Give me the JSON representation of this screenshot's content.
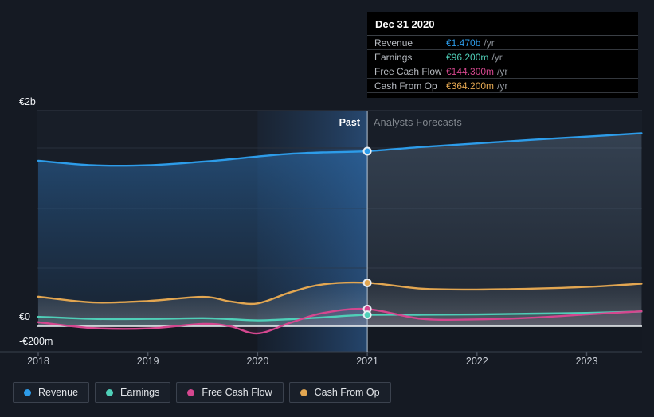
{
  "colors": {
    "revenue": "#2D9CE9",
    "earnings": "#4FCFB8",
    "free_cash_flow": "#D5478F",
    "cash_from_op": "#E2A651",
    "background": "#151A23",
    "plot_background": "#181E28",
    "tooltip_background": "#000000",
    "zero_line": "#F2F5F7"
  },
  "tooltip": {
    "date": "Dec 31 2020",
    "rows": [
      {
        "label": "Revenue",
        "value": "€1.470b",
        "suffix": "/yr",
        "series": "revenue"
      },
      {
        "label": "Earnings",
        "value": "€96.200m",
        "suffix": "/yr",
        "series": "earnings"
      },
      {
        "label": "Free Cash Flow",
        "value": "€144.300m",
        "suffix": "/yr",
        "series": "free_cash_flow"
      },
      {
        "label": "Cash From Op",
        "value": "€364.200m",
        "suffix": "/yr",
        "series": "cash_from_op"
      }
    ]
  },
  "annotations": {
    "past_label": "Past",
    "forecast_label": "Analysts Forecasts"
  },
  "y_axis": {
    "labels": [
      "€2b",
      "€0",
      "-€200m"
    ]
  },
  "x_axis": {
    "labels": [
      "2018",
      "2019",
      "2020",
      "2021",
      "2022",
      "2023"
    ]
  },
  "legend": {
    "items": [
      {
        "label": "Revenue",
        "series": "revenue"
      },
      {
        "label": "Earnings",
        "series": "earnings"
      },
      {
        "label": "Free Cash Flow",
        "series": "free_cash_flow"
      },
      {
        "label": "Cash From Op",
        "series": "cash_from_op"
      }
    ]
  },
  "chart_data": {
    "type": "line",
    "unit": "EUR millions per year",
    "x": [
      2018,
      2018.5,
      2019,
      2019.5,
      2019.75,
      2020,
      2020.3,
      2020.6,
      2021,
      2021.5,
      2022,
      2022.5,
      2023,
      2023.5
    ],
    "series": [
      {
        "name": "Revenue",
        "key": "revenue",
        "values": [
          1390,
          1352,
          1352,
          1382,
          1402,
          1425,
          1448,
          1460,
          1470,
          1505,
          1535,
          1565,
          1592,
          1620
        ]
      },
      {
        "name": "Earnings",
        "key": "earnings",
        "values": [
          80,
          62,
          62,
          68,
          60,
          50,
          60,
          75,
          96.2,
          97,
          100,
          106,
          112,
          124
        ]
      },
      {
        "name": "Free Cash Flow",
        "key": "free_cash_flow",
        "values": [
          35,
          -15,
          -18,
          20,
          0,
          -60,
          30,
          112,
          144.3,
          62,
          58,
          72,
          100,
          126
        ]
      },
      {
        "name": "Cash From Op",
        "key": "cash_from_op",
        "values": [
          248,
          200,
          212,
          247,
          208,
          192,
          285,
          352,
          364.2,
          315,
          308,
          315,
          330,
          357
        ]
      }
    ],
    "marker_x": 2021,
    "marker_values": {
      "revenue": 1470,
      "earnings": 96.2,
      "free_cash_flow": 144.3,
      "cash_from_op": 364.2
    },
    "divider_x": 2021,
    "highlight_band": [
      2020,
      2021
    ],
    "x_range": [
      2018,
      2023.5
    ],
    "ylim": [
      -215,
      2000
    ],
    "y_tick_values": [
      2000,
      0,
      -200
    ],
    "legend_position": "bottom"
  }
}
